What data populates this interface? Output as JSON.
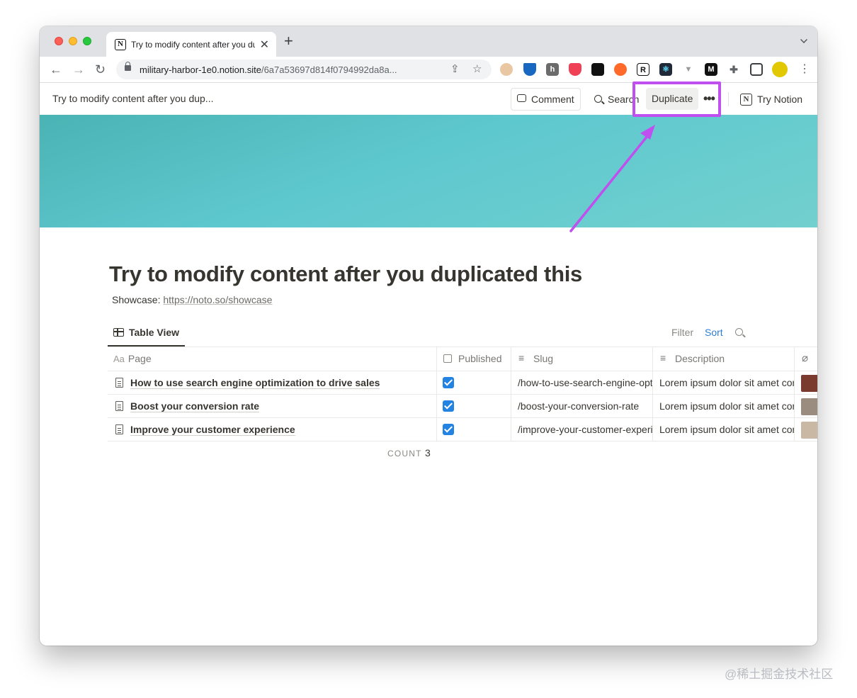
{
  "browser": {
    "tab_title": "Try to modify content after you duplicated this",
    "tab_favicon": "N",
    "url_host": "military-harbor-1e0.notion.site",
    "url_path": "/6a7a53697d814f0794992da8a...",
    "extensions": [
      "mask-icon",
      "vuetify-icon",
      "hc-icon",
      "pocket-icon",
      "film-icon",
      "orange-icon",
      "r-icon",
      "react-icon",
      "vue-icon",
      "m-icon",
      "puzzle-icon",
      "sidepanel-icon",
      "avatar-icon"
    ]
  },
  "notion_bar": {
    "breadcrumb": "Try to modify content after you dup...",
    "comment_label": "Comment",
    "search_label": "Search",
    "duplicate_label": "Duplicate",
    "more_label": "•••",
    "try_label": "Try Notion",
    "try_icon": "N"
  },
  "page": {
    "title": "Try to modify content after you duplicated this",
    "showcase_prefix": "Showcase: ",
    "showcase_link": "https://noto.so/showcase"
  },
  "view": {
    "tab_label": "Table View",
    "filter_label": "Filter",
    "sort_label": "Sort"
  },
  "table": {
    "page_prefix": "Aa",
    "columns": [
      "Page",
      "Published",
      "Slug",
      "Description"
    ],
    "rows": [
      {
        "page": "How to use search engine optimization to drive sales",
        "published": true,
        "slug": "/how-to-use-search-engine-optimization-to-drive-sales",
        "description": "Lorem ipsum dolor sit amet consectetur",
        "thumb_color": "#7a3b2e"
      },
      {
        "page": "Boost your conversion rate",
        "published": true,
        "slug": "/boost-your-conversion-rate",
        "description": "Lorem ipsum dolor sit amet consectetur",
        "thumb_color": "#9a8d80"
      },
      {
        "page": "Improve your customer experience",
        "published": true,
        "slug": "/improve-your-customer-experience",
        "description": "Lorem ipsum dolor sit amet consectetur",
        "thumb_color": "#c9b9a4"
      }
    ],
    "count_label": "COUNT",
    "count_value": "3"
  },
  "annotation": {
    "color": "#bf4fef"
  },
  "watermark": "@稀土掘金技术社区"
}
